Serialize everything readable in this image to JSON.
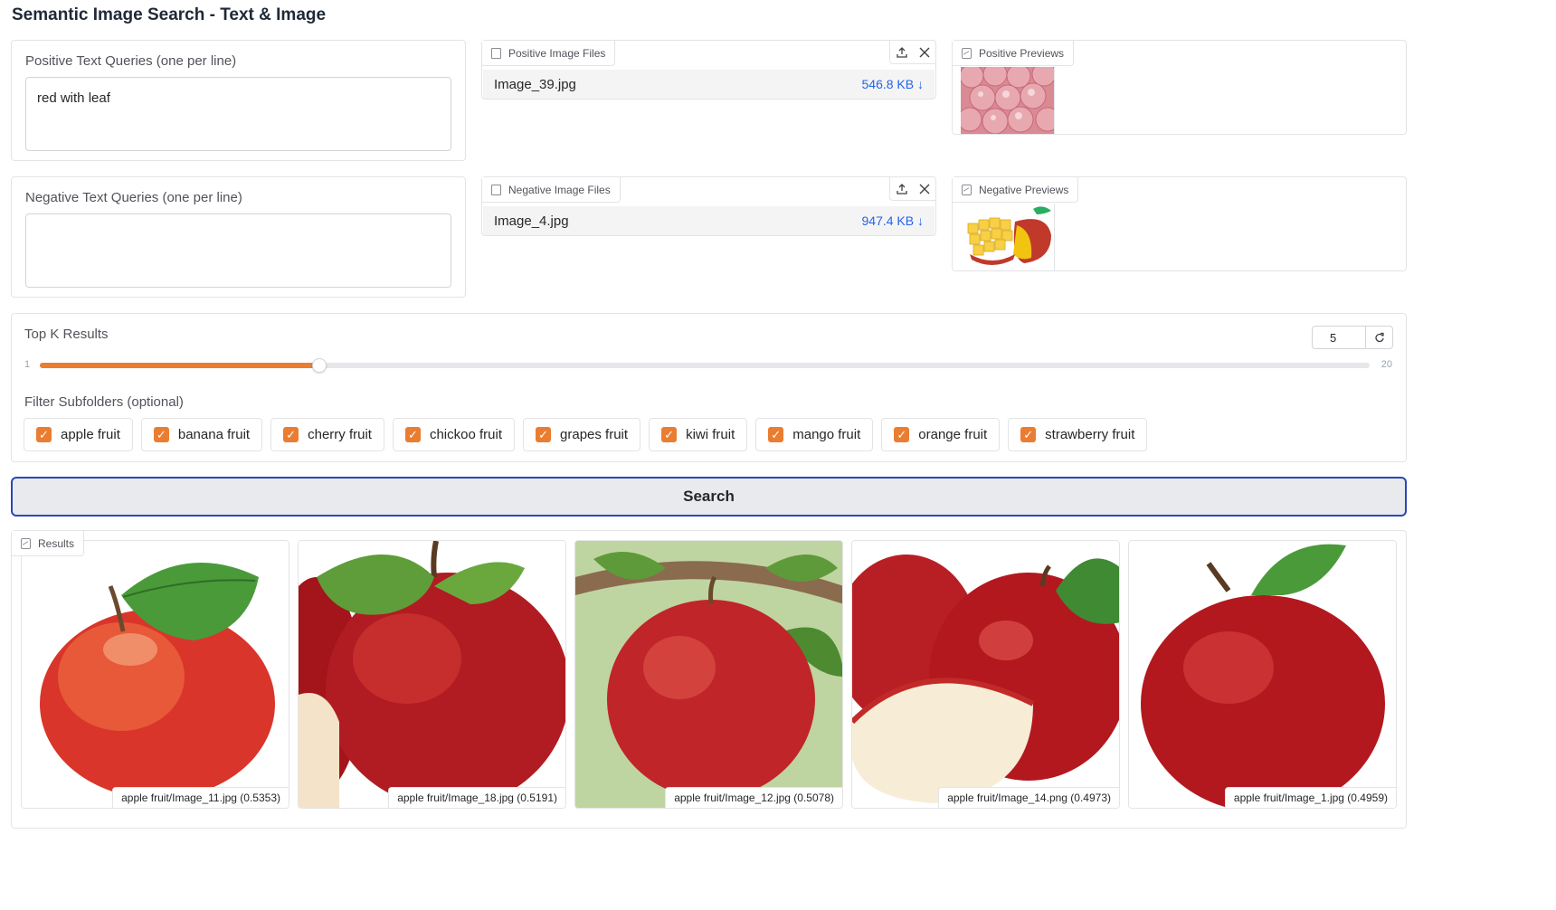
{
  "app": {
    "title": "Semantic Image Search - Text & Image"
  },
  "positive_text": {
    "label": "Positive Text Queries (one per line)",
    "value": "red with leaf"
  },
  "negative_text": {
    "label": "Negative Text Queries (one per line)",
    "value": ""
  },
  "positive_files": {
    "label": "Positive Image Files",
    "file": {
      "name": "Image_39.jpg",
      "size": "546.8 KB ↓"
    },
    "upload_icon": "upload-icon",
    "clear_icon": "close-icon"
  },
  "negative_files": {
    "label": "Negative Image Files",
    "file": {
      "name": "Image_4.jpg",
      "size": "947.4 KB ↓"
    },
    "upload_icon": "upload-icon",
    "clear_icon": "close-icon"
  },
  "positive_previews": {
    "label": "Positive Previews",
    "image": "pink apples in a pile"
  },
  "negative_previews": {
    "label": "Negative Previews",
    "image": "sliced mango"
  },
  "top_k": {
    "label": "Top K Results",
    "value": "5",
    "min": "1",
    "max": "20",
    "fraction": 0.21
  },
  "filter": {
    "label": "Filter Subfolders (optional)",
    "options": [
      {
        "label": "apple fruit",
        "checked": true
      },
      {
        "label": "banana fruit",
        "checked": true
      },
      {
        "label": "cherry fruit",
        "checked": true
      },
      {
        "label": "chickoo fruit",
        "checked": true
      },
      {
        "label": "grapes fruit",
        "checked": true
      },
      {
        "label": "kiwi fruit",
        "checked": true
      },
      {
        "label": "mango fruit",
        "checked": true
      },
      {
        "label": "orange fruit",
        "checked": true
      },
      {
        "label": "strawberry fruit",
        "checked": true
      }
    ]
  },
  "search": {
    "label": "Search"
  },
  "results": {
    "label": "Results",
    "items": [
      {
        "caption": "apple fruit/Image_11.jpg (0.5353)"
      },
      {
        "caption": "apple fruit/Image_18.jpg (0.5191)"
      },
      {
        "caption": "apple fruit/Image_12.jpg (0.5078)"
      },
      {
        "caption": "apple fruit/Image_14.png (0.4973)"
      },
      {
        "caption": "apple fruit/Image_1.jpg (0.4959)"
      }
    ]
  },
  "colors": {
    "accent": "#ea7d32",
    "button_border": "#2948b9",
    "link": "#2563eb"
  }
}
